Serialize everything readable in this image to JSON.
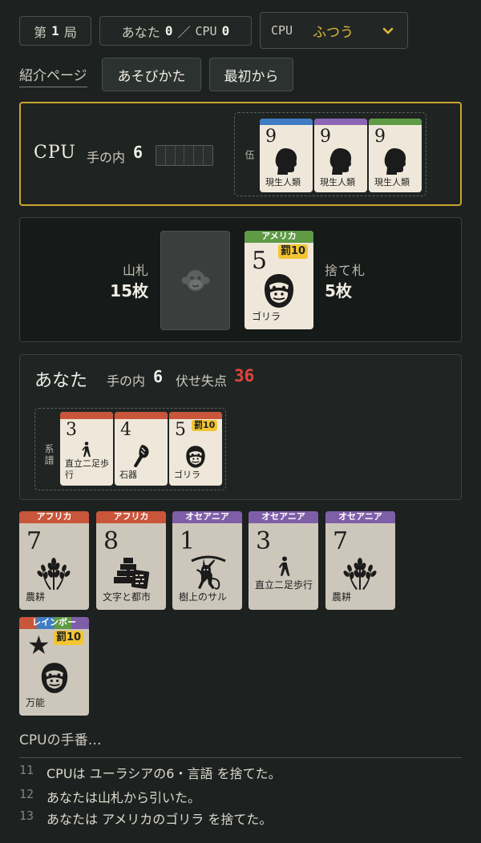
{
  "topbar": {
    "round_pre": "第",
    "round": "1",
    "round_post": "局",
    "score_you_label": "あなた",
    "score_you": "0",
    "score_sep": "／",
    "score_cpu_label": "CPU",
    "score_cpu": "0",
    "level_label": "CPU",
    "level_value": "ふつう"
  },
  "nav": {
    "intro": "紹介ページ",
    "howto": "あそびかた",
    "restart": "最初から"
  },
  "cpu_panel": {
    "name": "CPU",
    "hand_label": "手の内",
    "hand_count": "6",
    "meld_label": "伍",
    "meld_cards": [
      {
        "number": "9",
        "name": "現生人類",
        "color": "#3f7cc2",
        "icon": "human-head-icon"
      },
      {
        "number": "9",
        "name": "現生人類",
        "color": "#8a66b4",
        "icon": "human-head-icon"
      },
      {
        "number": "9",
        "name": "現生人類",
        "color": "#5f9a45",
        "icon": "human-head-icon"
      }
    ]
  },
  "center": {
    "deck_label": "山札",
    "deck_count": "15枚",
    "discard_label": "捨て札",
    "discard_count": "5枚",
    "top_discard": {
      "region": "アメリカ",
      "number": "5",
      "penalty": "罰10",
      "name": "ゴリラ",
      "color": "#5f9a45",
      "icon": "gorilla-icon"
    }
  },
  "player_panel": {
    "name": "あなた",
    "hand_label": "手の内",
    "hand_count": "6",
    "lose_label": "伏せ失点",
    "lose_points": "36",
    "meld_label": "系譜",
    "meld_cards": [
      {
        "number": "3",
        "name": "直立二足歩行",
        "color": "#c9553a",
        "icon": "walking-human-icon"
      },
      {
        "number": "4",
        "name": "石器",
        "color": "#c9553a",
        "icon": "stone-tool-icon"
      },
      {
        "number": "5",
        "name": "ゴリラ",
        "penalty": "罰10",
        "color": "#c9553a",
        "icon": "gorilla-icon"
      }
    ]
  },
  "hand": [
    {
      "region": "アフリカ",
      "number": "7",
      "name": "農耕",
      "color": "#c9553a",
      "icon": "wheat-icon"
    },
    {
      "region": "アフリカ",
      "number": "8",
      "name": "文字と都市",
      "color": "#c9553a",
      "icon": "pyramid-tablet-icon"
    },
    {
      "region": "オセアニア",
      "number": "1",
      "name": "樹上のサル",
      "color": "#7f5ea8",
      "icon": "monkey-icon"
    },
    {
      "region": "オセアニア",
      "number": "3",
      "name": "直立二足歩行",
      "color": "#7f5ea8",
      "icon": "walking-human-icon"
    },
    {
      "region": "オセアニア",
      "number": "7",
      "name": "農耕",
      "color": "#7f5ea8",
      "icon": "wheat-icon"
    },
    {
      "region": "レインボー",
      "number": "★",
      "penalty": "罰10",
      "name": "万能",
      "color": "#7a57a8",
      "icon": "gorilla-icon"
    }
  ],
  "status": "CPUの手番…",
  "log": [
    {
      "n": "11",
      "text": "CPUは ユーラシアの6・言語 を捨てた。"
    },
    {
      "n": "12",
      "text": "あなたは山札から引いた。"
    },
    {
      "n": "13",
      "text": "あなたは アメリカのゴリラ を捨てた。"
    }
  ],
  "colors": {
    "accent": "#c9a530",
    "penalty": "#f2c531",
    "danger": "#e2443a"
  }
}
